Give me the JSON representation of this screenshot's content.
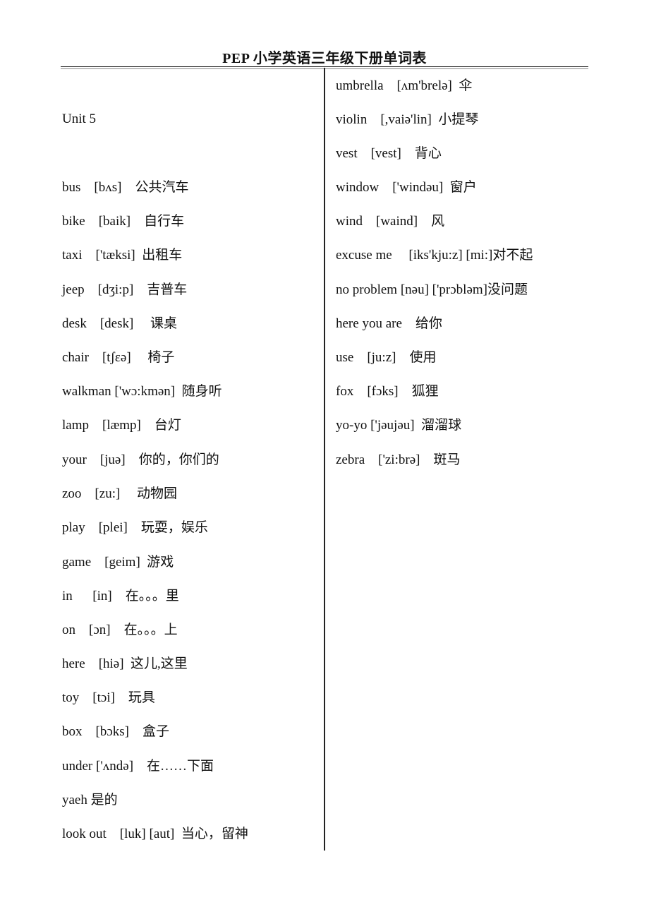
{
  "document": {
    "title": "PEP 小学英语三年级下册单词表"
  },
  "left_column": {
    "heading": "Unit 5",
    "entries": [
      {
        "word": "bus",
        "phonetic": "[bʌs]",
        "meaning": "公共汽车",
        "text": "bus    [bʌs]    公共汽车"
      },
      {
        "word": "bike",
        "phonetic": "[baik]",
        "meaning": "自行车",
        "text": "bike    [baik]    自行车"
      },
      {
        "word": "taxi",
        "phonetic": "['tæksi]",
        "meaning": "出租车",
        "text": "taxi    ['tæksi]  出租车"
      },
      {
        "word": "jeep",
        "phonetic": "[dʒi:p]",
        "meaning": "吉普车",
        "text": "jeep    [dʒi:p]    吉普车"
      },
      {
        "word": "desk",
        "phonetic": "[desk]",
        "meaning": "课桌",
        "text": "desk    [desk]     课桌"
      },
      {
        "word": "chair",
        "phonetic": "[tʃɛə]",
        "meaning": "椅子",
        "text": "chair    [tʃɛə]     椅子"
      },
      {
        "word": "walkman",
        "phonetic": "['wɔ:kmən]",
        "meaning": "随身听",
        "text": "walkman ['wɔ:kmən]  随身听"
      },
      {
        "word": "lamp",
        "phonetic": "[læmp]",
        "meaning": "台灯",
        "text": "lamp    [læmp]    台灯"
      },
      {
        "word": "your",
        "phonetic": "[juə]",
        "meaning": "你的，你们的",
        "text": "your    [juə]    你的，你们的"
      },
      {
        "word": "zoo",
        "phonetic": "[zu:]",
        "meaning": "动物园",
        "text": "zoo    [zu:]     动物园"
      },
      {
        "word": "play",
        "phonetic": "[plei]",
        "meaning": "玩耍，娱乐",
        "text": "play    [plei]    玩耍，娱乐"
      },
      {
        "word": "game",
        "phonetic": "[geim]",
        "meaning": "游戏",
        "text": "game    [geim]  游戏"
      },
      {
        "word": "in",
        "phonetic": "[in]",
        "meaning": "在。。。里",
        "text": "in      [in]    在。。。里"
      },
      {
        "word": "on",
        "phonetic": "[ɔn]",
        "meaning": "在。。。上",
        "text": "on    [ɔn]    在。。。上"
      },
      {
        "word": "here",
        "phonetic": "[hiə]",
        "meaning": "这儿,这里",
        "text": "here    [hiə]  这儿,这里"
      },
      {
        "word": "toy",
        "phonetic": "[tɔi]",
        "meaning": "玩具",
        "text": "toy    [tɔi]    玩具"
      },
      {
        "word": "box",
        "phonetic": "[bɔks]",
        "meaning": "盒子",
        "text": "box    [bɔks]    盒子"
      },
      {
        "word": "under",
        "phonetic": "['ʌndə]",
        "meaning": "在……下面",
        "text": "under ['ʌndə]    在……下面"
      },
      {
        "word": "yaeh",
        "phonetic": "",
        "meaning": "是的",
        "text": "yaeh 是的"
      },
      {
        "word": "look out",
        "phonetic": "[luk] [aut]",
        "meaning": "当心，留神",
        "text": "look out    [luk] [aut]  当心，留神"
      }
    ]
  },
  "right_column": {
    "entries": [
      {
        "word": "umbrella",
        "phonetic": "[ʌm'brelə]",
        "meaning": "伞",
        "text": "umbrella    [ʌm'brelə]  伞"
      },
      {
        "word": "violin",
        "phonetic": "[,vaiə'lin]",
        "meaning": "小提琴",
        "text": "violin    [,vaiə'lin]  小提琴"
      },
      {
        "word": "vest",
        "phonetic": "[vest]",
        "meaning": "背心",
        "text": "vest    [vest]    背心"
      },
      {
        "word": "window",
        "phonetic": "['windəu]",
        "meaning": "窗户",
        "text": "window    ['windəu]  窗户"
      },
      {
        "word": "wind",
        "phonetic": "[waind]",
        "meaning": "风",
        "text": "wind    [waind]    风"
      },
      {
        "word": "excuse me",
        "phonetic": "[iks'kju:z] [mi:]",
        "meaning": "对不起",
        "text": "excuse me     [iks'kju:z] [mi:]对不起"
      },
      {
        "word": "no problem",
        "phonetic": "[nəu] ['prɔbləm]",
        "meaning": "没问题",
        "text": "no problem [nəu] ['prɔbləm]没问题"
      },
      {
        "word": "here you are",
        "phonetic": "",
        "meaning": "给你",
        "text": "here you are    给你"
      },
      {
        "word": "use",
        "phonetic": "[ju:z]",
        "meaning": "使用",
        "text": "use    [ju:z]    使用"
      },
      {
        "word": "fox",
        "phonetic": "[fɔks]",
        "meaning": "狐狸",
        "text": "fox    [fɔks]    狐狸"
      },
      {
        "word": "yo-yo",
        "phonetic": "['jəujəu]",
        "meaning": "溜溜球",
        "text": "yo-yo ['jəujəu]  溜溜球"
      },
      {
        "word": "zebra",
        "phonetic": "['zi:brə]",
        "meaning": "斑马",
        "text": "zebra    ['zi:brə]    斑马"
      }
    ]
  }
}
